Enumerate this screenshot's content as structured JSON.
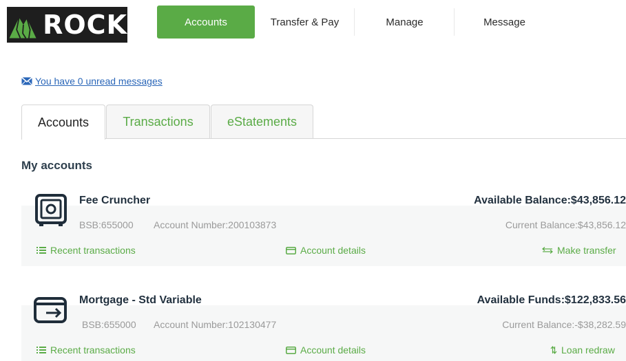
{
  "brand": {
    "name": "ROCK",
    "accent": "#5aab46"
  },
  "topnav": {
    "items": [
      {
        "label": "Accounts"
      },
      {
        "label": "Transfer & Pay"
      },
      {
        "label": "Manage"
      },
      {
        "label": "Message"
      }
    ]
  },
  "messages": {
    "text": "You have 0 unread messages",
    "icon": "envelope-icon"
  },
  "tabs": [
    {
      "label": "Accounts"
    },
    {
      "label": "Transactions"
    },
    {
      "label": "eStatements"
    }
  ],
  "section_title": "My accounts",
  "accounts": [
    {
      "name": "Fee Cruncher",
      "icon": "safe-icon",
      "balance_label": "Available Balance:$43,856.12",
      "bsb": "BSB:655000",
      "account_number": "Account Number:200103873",
      "current_balance": "Current Balance:$43,856.12",
      "links": {
        "recent": "Recent transactions",
        "details": "Account details",
        "action": "Make transfer"
      }
    },
    {
      "name": "Mortgage - Std Variable",
      "icon": "card-arrow-icon",
      "balance_label": "Available Funds:$122,833.56",
      "bsb": "BSB:655000",
      "account_number": "Account Number:102130477",
      "current_balance": "Current Balance:-$38,282.59",
      "links": {
        "recent": "Recent transactions",
        "details": "Account details",
        "action": "Loan redraw"
      }
    }
  ]
}
